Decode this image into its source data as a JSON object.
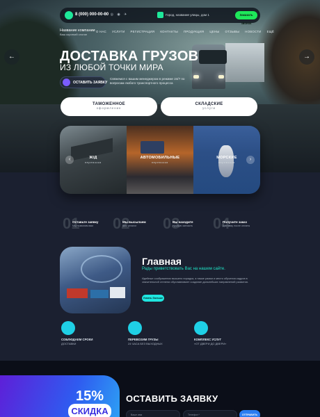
{
  "header": {
    "phone": "8 (000) 000-00-00",
    "social": "✆ ◎ ◉ ✈",
    "address": "Город, название улицы, дом 1",
    "call_button": "Заказать звонок",
    "logo_title": "Название компании",
    "logo_subtitle": "Ваш короткий слоган",
    "nav": [
      "О НАС",
      "УСЛУГИ",
      "РЕГИСТРАЦИЯ",
      "КОНТАКТЫ",
      "ПРОДУКЦИЯ",
      "ЦЕНЫ",
      "ОТЗЫВЫ",
      "НОВОСТИ",
      "ЕЩЁ"
    ]
  },
  "hero": {
    "title": "ДОСТАВКА ГРУЗОВ",
    "subtitle": "ИЗ ЛЮБОЙ ТОЧКИ МИРА",
    "request_button": "ОСТАВИТЬ ЗАЯВКУ",
    "promo": "Свяжемся с вашим менеджером в режиме 24/7 по вопросам любого транспортного процесса",
    "prev": "←",
    "next": "→"
  },
  "services": [
    {
      "title": "ТАМОЖЕННОЕ",
      "sub": "оформление"
    },
    {
      "title": "СКЛАДСКИЕ",
      "sub": "услуги"
    }
  ],
  "transport": [
    {
      "title": "Ж/Д",
      "sub": "перевозки"
    },
    {
      "title": "АВТОМОБИЛЬНЫЕ",
      "sub": "перевозки"
    },
    {
      "title": "МОРСКИЕ",
      "sub": "перевозки"
    }
  ],
  "carousel_prev": "‹",
  "carousel_next": "›",
  "steps": [
    {
      "num": "01",
      "title": "Оставьте заявку",
      "sub": "Мы позвоним вам"
    },
    {
      "num": "02",
      "title": "Мы высылаем",
      "sub": "Вам каталог"
    },
    {
      "num": "03",
      "title": "Вы находите",
      "sub": "Нужную запчасть"
    },
    {
      "num": "04",
      "title": "Получите заказ",
      "sub": "Доставку после оплаты"
    }
  ],
  "about": {
    "title": "Главная",
    "subtitle": "Рады приветствовать Вас на нашем сайте.",
    "text": "Идейные соображения высшего порядка, а также рамки и место обучения кадров в значительной степени обуславливает создание дальнейших направлений развития.",
    "more_button": "Узнать больше"
  },
  "features": [
    {
      "title": "СОБЛЮДАЕМ СРОКИ",
      "sub": "ДОСТАВКИ"
    },
    {
      "title": "ПЕРЕВОЗИМ ГРУЗЫ",
      "sub": "24 ЧАСА БЕЗ ВЫХОДНЫХ"
    },
    {
      "title": "КОМПЛЕКС УСЛУГ",
      "sub": "«ОТ ДВЕРИ ДО ДВЕРИ»"
    }
  ],
  "order": {
    "discount_value": "15%",
    "discount_label": "СКИДКА",
    "title": "ОСТАВИТЬ ЗАЯВКУ",
    "name_placeholder": "Ваше имя",
    "phone_placeholder": "Телефон *",
    "send_button": "ОТПРАВИТЬ"
  },
  "colors": {
    "accent_green": "#1ee85a",
    "accent_cyan": "#1fe6e0",
    "background": "#1b2030"
  }
}
